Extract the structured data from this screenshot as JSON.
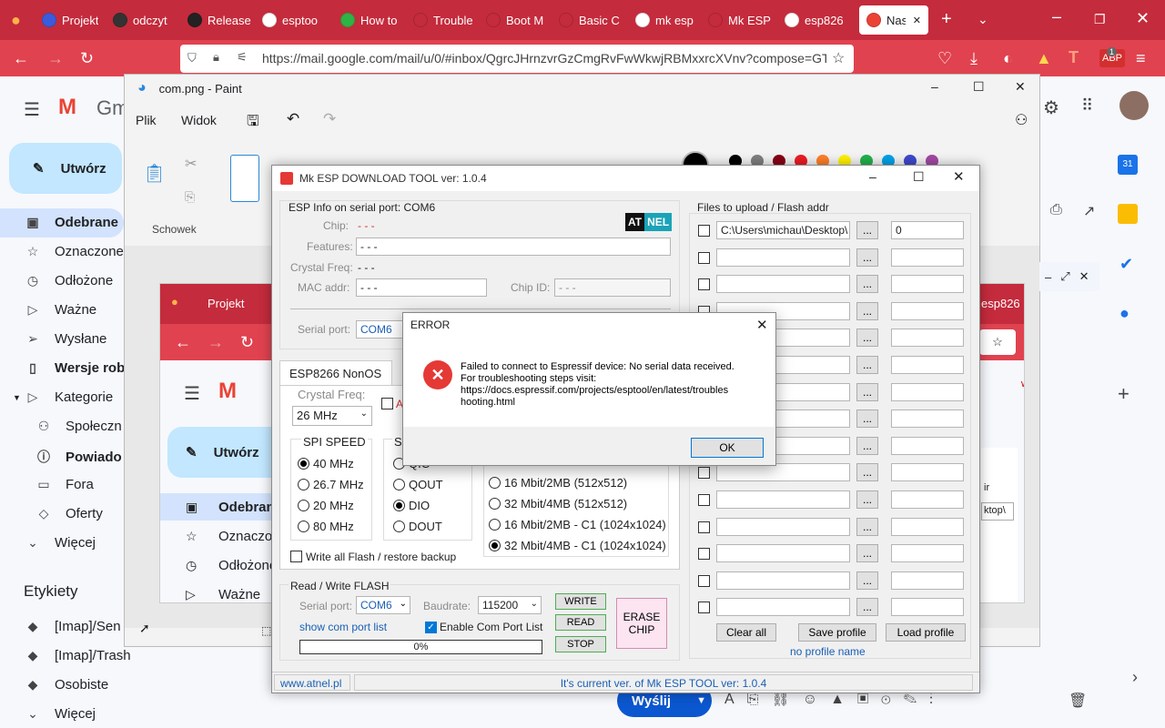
{
  "browser": {
    "tabs": [
      {
        "label": "Projekt",
        "color": "#3b5bdb"
      },
      {
        "label": "odczyt",
        "color": "#333333"
      },
      {
        "label": "Release",
        "color": "#222222"
      },
      {
        "label": "esptoo",
        "color": "#ffffff"
      },
      {
        "label": "How to",
        "color": "#2fb344"
      },
      {
        "label": "Trouble",
        "color": "#c42b3c"
      },
      {
        "label": "Boot M",
        "color": "#c42b3c"
      },
      {
        "label": "Basic C",
        "color": "#c42b3c"
      },
      {
        "label": "mk esp",
        "color": "#ffffff"
      },
      {
        "label": "Mk ESP",
        "color": "#c42b3c"
      },
      {
        "label": "esp826",
        "color": "#ffffff"
      },
      {
        "label": "Nas",
        "color": "#ea4335"
      }
    ],
    "url": "https://mail.google.com/mail/u/0/#inbox/QgrcJHrnzvrGzCmgRvFwWkwjRBMxxrcXVnv?compose=GTv",
    "addon_badge": "1"
  },
  "gmail": {
    "logo_text": "Gm",
    "compose_label": "Utwórz",
    "nav": [
      {
        "label": "Odebrane",
        "icon": "inbox-icon",
        "bold": true
      },
      {
        "label": "Oznaczone",
        "icon": "star-icon"
      },
      {
        "label": "Odłożone",
        "icon": "clock-icon"
      },
      {
        "label": "Ważne",
        "icon": "important-icon"
      },
      {
        "label": "Wysłane",
        "icon": "send-icon"
      },
      {
        "label": "Wersje rob",
        "icon": "draft-icon",
        "bold": true
      },
      {
        "label": "Kategorie",
        "icon": "label-icon"
      },
      {
        "label": "Społeczn",
        "icon": "people-icon"
      },
      {
        "label": "Powiado",
        "icon": "info-icon",
        "bold": true
      },
      {
        "label": "Fora",
        "icon": "forum-icon"
      },
      {
        "label": "Oferty",
        "icon": "tag-icon"
      },
      {
        "label": "Więcej",
        "icon": "chevron-down-icon"
      }
    ],
    "labels_heading": "Etykiety",
    "labels": [
      "[Imap]/Sen",
      "[Imap]/Trash",
      "Osobiste",
      "Więcej"
    ],
    "send_label": "Wyślij"
  },
  "paint": {
    "title": "com.png - Paint",
    "menu": [
      "Plik",
      "Widok"
    ],
    "group_label": "Schowek",
    "palette": [
      "#000000",
      "#7f7f7f",
      "#880015",
      "#ed1c24",
      "#ff7f27",
      "#fff200",
      "#22b14c",
      "#00a2e8",
      "#3f48cc",
      "#a349a4"
    ],
    "inner": {
      "tabs": [
        "Projekt",
        "esp826"
      ],
      "compose_label": "Utwórz",
      "nav": [
        "Odebran",
        "Oznaczor",
        "Odłożone",
        "Ważne"
      ],
      "field_value": "ktop\\",
      "extra_text": "ir",
      "w_text": "w"
    }
  },
  "esp": {
    "title": "Mk ESP DOWNLOAD TOOL  ver: 1.0.4",
    "info_heading": "ESP Info on serial port: COM6",
    "chip_label": "Chip:",
    "chip_value": "- - -",
    "features_label": "Features:",
    "features_value": "- - -",
    "crystal_label": "Crystal Freq:",
    "crystal_value": "- - -",
    "mac_label": "MAC addr:",
    "mac_value": "- - -",
    "chipid_label": "Chip ID:",
    "chipid_value": "- - -",
    "logo_a": "AT",
    "logo_b": "NEL",
    "serial_label": "Serial port:",
    "serial_value": "COM6",
    "tab_label": "ESP8266 NonOS",
    "crystal2_label": "Crystal Freq:",
    "crystal2_value": "26 MHz",
    "a_label": "A",
    "spi_speed_heading": "SPI SPEED",
    "spi_speed": [
      {
        "label": "40 MHz",
        "on": true
      },
      {
        "label": "26.7 MHz"
      },
      {
        "label": "20 MHz"
      },
      {
        "label": "80 MHz"
      }
    ],
    "spi_mode_heading": "SP",
    "spi_mode": [
      {
        "label": "QIO"
      },
      {
        "label": "QOUT"
      },
      {
        "label": "DIO",
        "on": true
      },
      {
        "label": "DOUT"
      }
    ],
    "flash_size": [
      {
        "label": "16 Mbit/2MB (512x512)"
      },
      {
        "label": "32 Mbit/4MB (512x512)"
      },
      {
        "label": "16 Mbit/2MB - C1 (1024x1024)"
      },
      {
        "label": "32 Mbit/4MB - C1 (1024x1024)",
        "on": true
      }
    ],
    "write_all_label": "Write all Flash / restore backup",
    "rw_heading": "Read / Write FLASH",
    "rw_serial_label": "Serial port:",
    "rw_serial_value": "COM6",
    "baud_label": "Baudrate:",
    "baud_value": "115200",
    "write_btn": "WRITE",
    "read_btn": "READ",
    "stop_btn": "STOP",
    "erase_btn_1": "ERASE",
    "erase_btn_2": "CHIP",
    "show_com_link": "show com port list",
    "enable_com_label": "Enable Com Port List",
    "progress_value": 0,
    "progress_text": "0%",
    "files_heading": "Files to upload / Flash addr",
    "files": [
      {
        "path": "C:\\Users\\michau\\Desktop\\",
        "addr": "0"
      },
      {
        "path": "",
        "addr": ""
      },
      {
        "path": "",
        "addr": ""
      },
      {
        "path": "",
        "addr": ""
      },
      {
        "path": "",
        "addr": ""
      },
      {
        "path": "",
        "addr": ""
      },
      {
        "path": "",
        "addr": ""
      },
      {
        "path": "",
        "addr": ""
      },
      {
        "path": "",
        "addr": ""
      },
      {
        "path": "",
        "addr": ""
      },
      {
        "path": "",
        "addr": ""
      },
      {
        "path": "",
        "addr": ""
      },
      {
        "path": "",
        "addr": ""
      },
      {
        "path": "",
        "addr": ""
      },
      {
        "path": "",
        "addr": ""
      }
    ],
    "browse_label": "...",
    "clear_btn": "Clear all",
    "save_btn": "Save profile",
    "load_btn": "Load profile",
    "profile_name": "no profile name",
    "status_left": "www.atnel.pl",
    "status_right": "It's current ver. of Mk ESP TOOL ver: 1.0.4"
  },
  "error_dialog": {
    "title": "ERROR",
    "message_lines": [
      "Failed to connect to Espressif device: No serial data received.",
      "For troubleshooting steps visit:",
      "https://docs.espressif.com/projects/esptool/en/latest/troubles",
      "hooting.html"
    ],
    "ok_label": "OK"
  }
}
